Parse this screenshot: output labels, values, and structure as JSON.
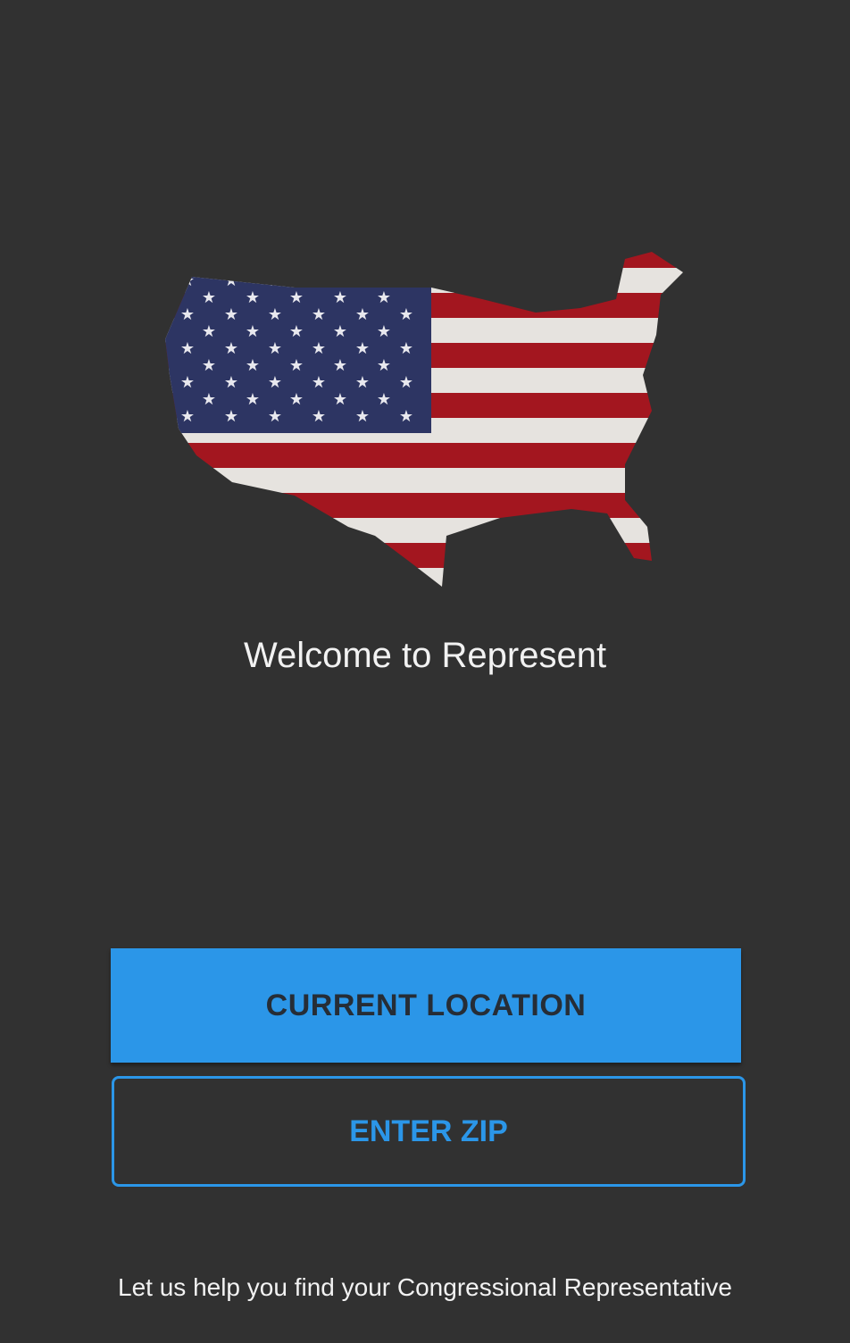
{
  "hero": {
    "image": "us-flag-map",
    "colors": {
      "red": "#a3161f",
      "white": "#e6e3df",
      "blue": "#2d3563"
    }
  },
  "welcome_text": "Welcome to Represent",
  "buttons": {
    "current_location": "CURRENT LOCATION",
    "enter_zip": "ENTER ZIP"
  },
  "tagline": "Let us help you find your Congressional Representative",
  "colors": {
    "background": "#313131",
    "accent": "#2b96e8"
  }
}
